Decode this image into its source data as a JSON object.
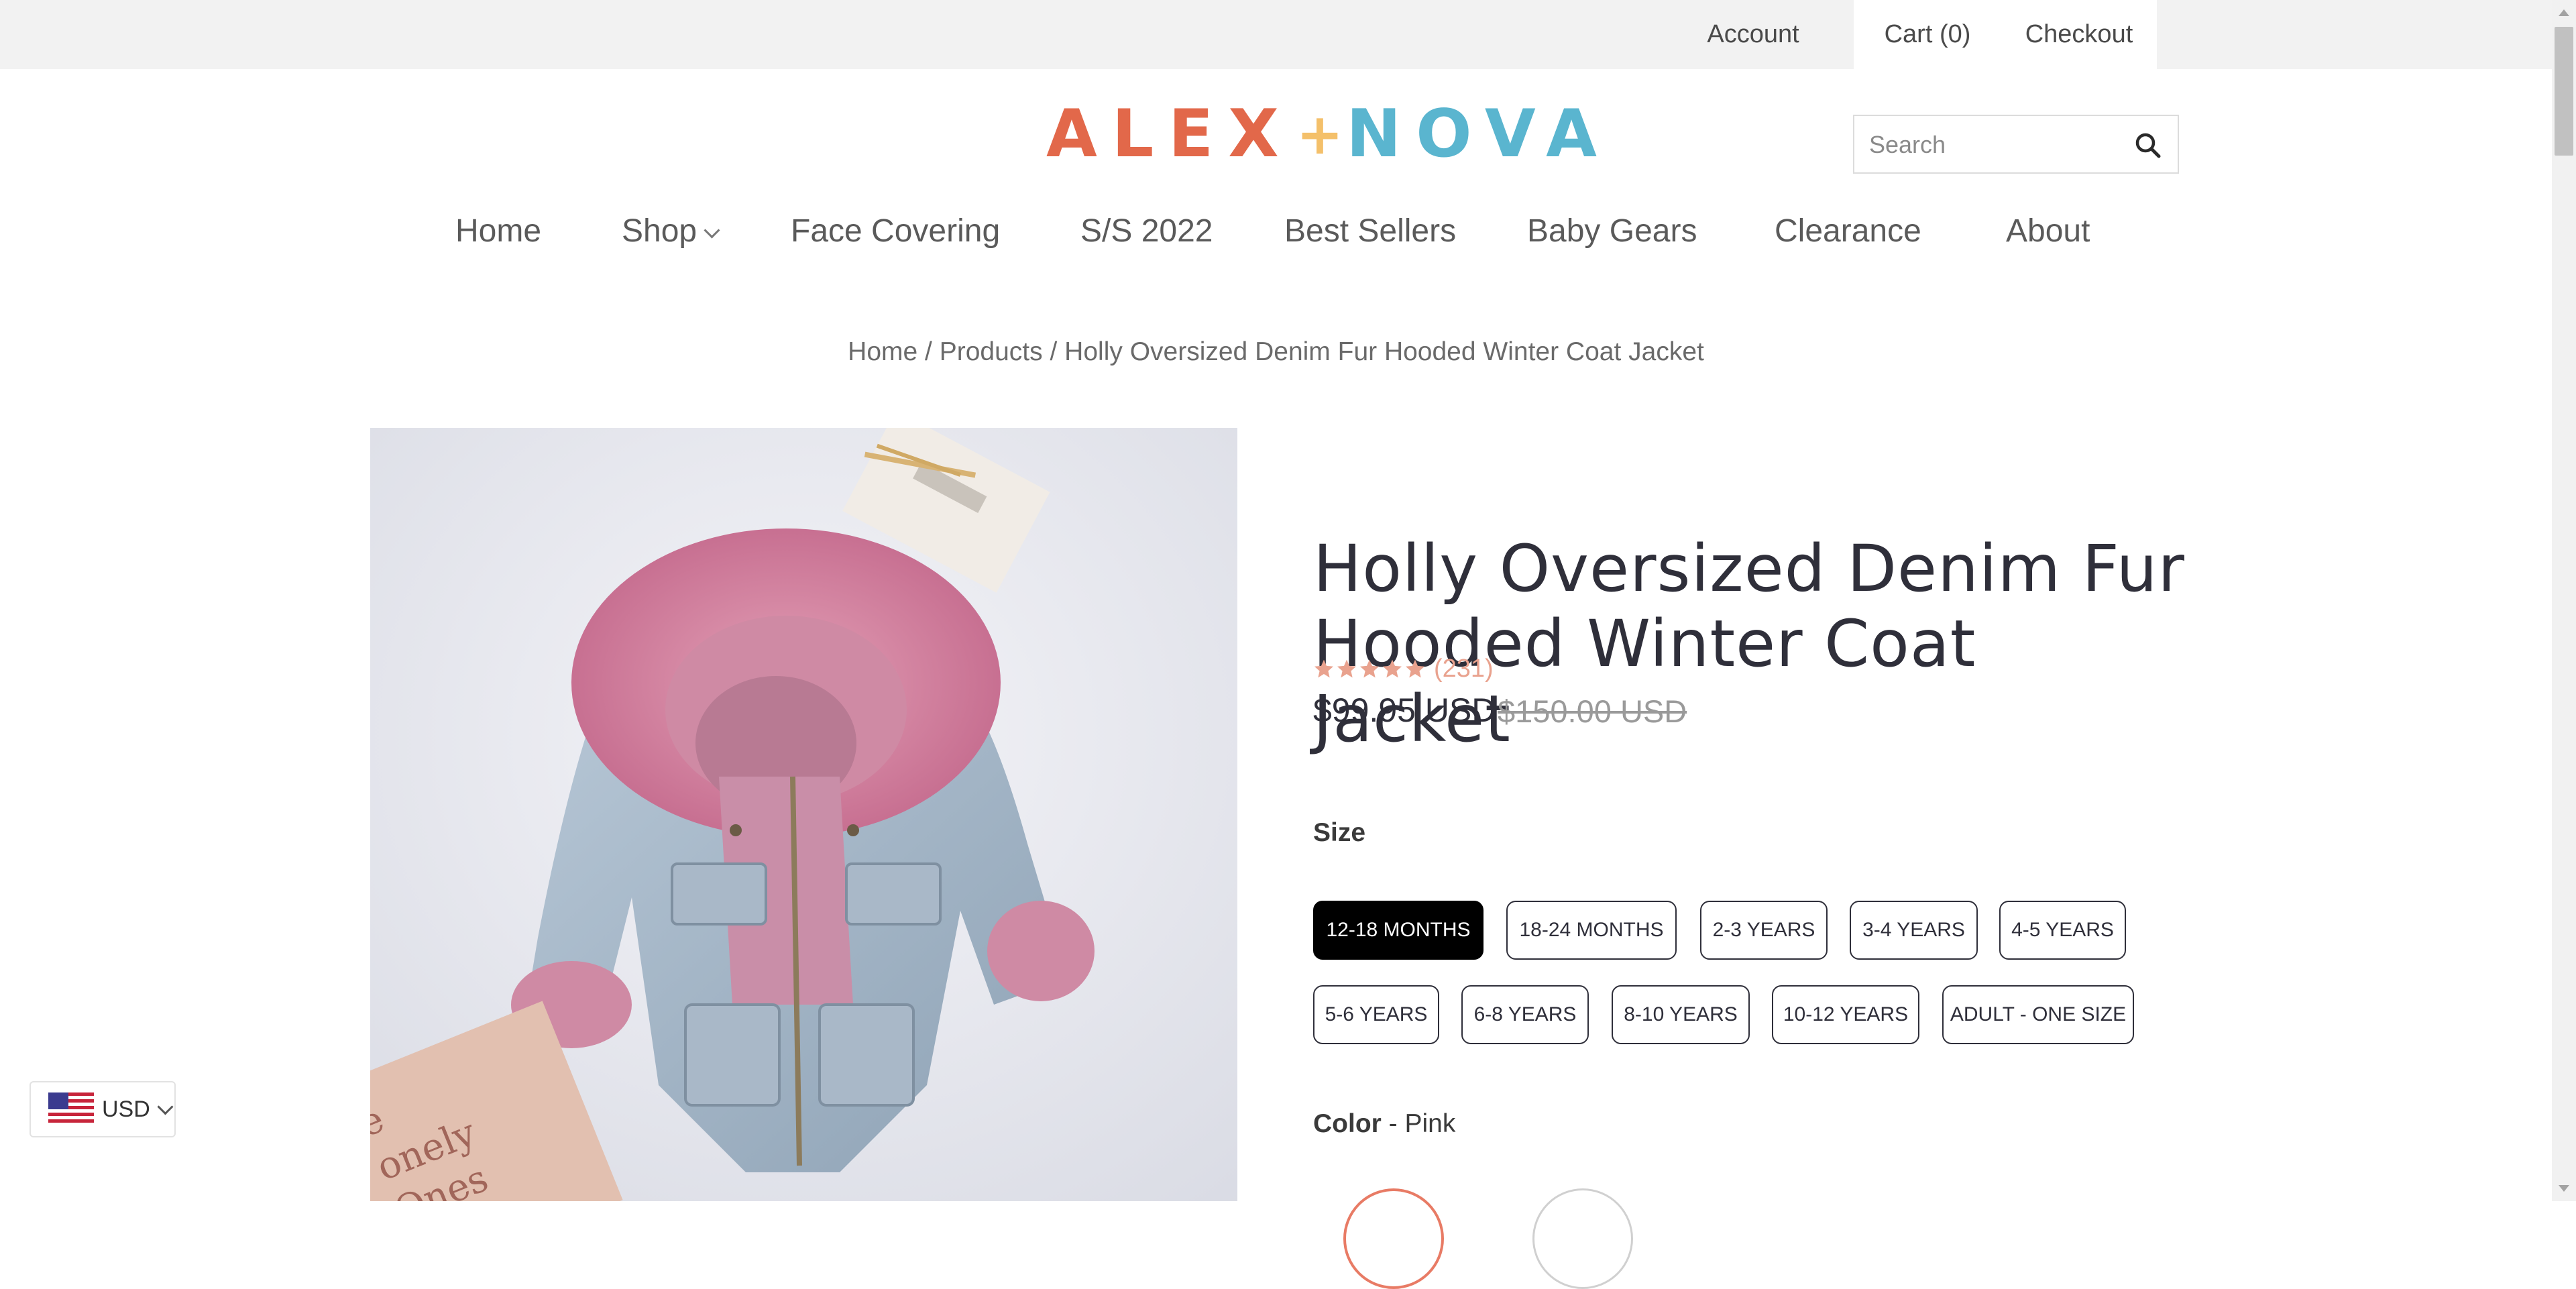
{
  "topbar": {
    "account": "Account",
    "cart": "Cart (0)",
    "checkout": "Checkout"
  },
  "logo": {
    "part1": "ALEX",
    "plus": "+",
    "part2": "NOVA",
    "colors": {
      "alex": "#e2684a",
      "plus": "#f4c06a",
      "nova": "#5ab5cf"
    }
  },
  "search": {
    "placeholder": "Search",
    "icon": "search-icon"
  },
  "nav": {
    "items": [
      "Home",
      "Shop",
      "Face Covering",
      "S/S 2022",
      "Best Sellers",
      "Baby Gears",
      "Clearance",
      "About"
    ]
  },
  "breadcrumb": {
    "home": "Home",
    "sep1": "/",
    "products": "Products",
    "sep2": "/",
    "current": "Holly Oversized Denim Fur Hooded Winter Coat Jacket"
  },
  "product": {
    "title": "Holly Oversized Denim Fur Hooded Winter Coat Jacket",
    "rating_stars": 5,
    "review_count": "(231)",
    "price": "$99.95 USD",
    "compare_price": "$150.00 USD",
    "book_text": "e\nonely\nOnes",
    "size": {
      "label": "Size",
      "options": [
        "12-18 MONTHS",
        "18-24 MONTHS",
        "2-3 YEARS",
        "3-4 YEARS",
        "4-5 YEARS",
        "5-6 YEARS",
        "6-8 YEARS",
        "8-10 YEARS",
        "10-12 YEARS",
        "ADULT - ONE SIZE"
      ],
      "selected": "12-18 MONTHS"
    },
    "color": {
      "label": "Color",
      "separator": " - ",
      "value": "Pink"
    }
  },
  "currency": {
    "code": "USD",
    "flag": "us-flag-icon"
  }
}
